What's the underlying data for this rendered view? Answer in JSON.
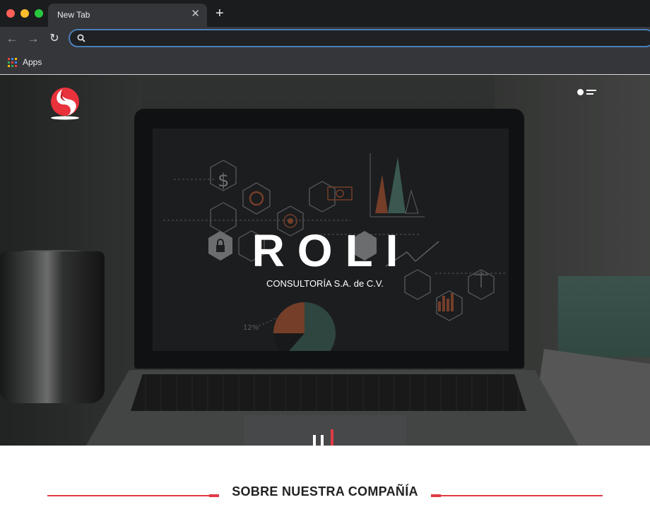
{
  "browser": {
    "tab_title": "New Tab",
    "tab_close": "✕",
    "new_tab": "+",
    "back": "←",
    "forward": "→",
    "reload": "↻",
    "address": "",
    "bookmarks": [
      {
        "label": "Apps"
      }
    ]
  },
  "hero": {
    "title": "ROLI",
    "subtitle": "CONSULTORÍA S.A. de C.V.",
    "screen_texts": {
      "dollar": "$",
      "percent": "12%"
    }
  },
  "about": {
    "title": "SOBRE NUESTRA COMPAÑÍA"
  },
  "colors": {
    "accent": "#e03b45",
    "omnibox_border": "#4b7fb8",
    "tabbar": "#1b1c1e",
    "toolbar": "#35363a"
  },
  "icons": {
    "logo": "roli-logo",
    "menu": "menu-toggle-icon",
    "search": "search-icon",
    "apps": "apps-grid-icon"
  }
}
